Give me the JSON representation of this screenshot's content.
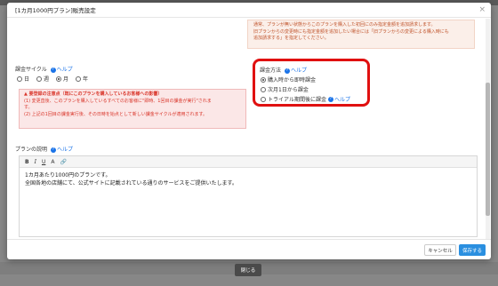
{
  "modal": {
    "title": "[1カ月1000円プラン]販売設定",
    "close_glyph": "×"
  },
  "info_box": {
    "lines": [
      "通常、プランが無い状態からこのプランを購入した初回にのみ指定金額を追加請求します。",
      "旧プランからの変更時にも指定金額を追加したい場合には「旧プランからの変更による購入時にも",
      "追加請求する」を指定してください。"
    ]
  },
  "billing_cycle": {
    "label": "課金サイクル",
    "help": "ヘルプ",
    "options": [
      "日",
      "週",
      "月",
      "年"
    ],
    "selected": "月"
  },
  "warning": {
    "title": "▲ 要登録の注意点（既にこのプランを購入しているお客様への影響）",
    "lines": [
      "(1) 変更直後、このプランを購入しているすべてのお客様に\"即時、1回目の課金が実行\"されま",
      "す。",
      "(2) 上記の1回目の課金実行後、その日時を始点として新しい課金サイクルが適用されます。"
    ]
  },
  "billing_method": {
    "label": "課金方法",
    "help": "ヘルプ",
    "options": [
      "購入時から即時課金",
      "次月1日から課金",
      "トライアル期間後に課金"
    ],
    "selected": "購入時から即時課金",
    "trial_help": "ヘルプ"
  },
  "plan_description": {
    "label": "プランの説明",
    "help": "ヘルプ",
    "toolbar": {
      "bold": "B",
      "italic": "I",
      "underline": "U",
      "font_color": "A",
      "link": "🔗"
    },
    "lines": [
      "1カ月あたり1000円のプランです。",
      "全国各地の店舗にて、公式サイトに記載されている通りのサービスをご提供いたします。"
    ]
  },
  "footer": {
    "cancel": "キャンセル",
    "save": "保存する"
  },
  "background": {
    "close": "閉じる"
  }
}
